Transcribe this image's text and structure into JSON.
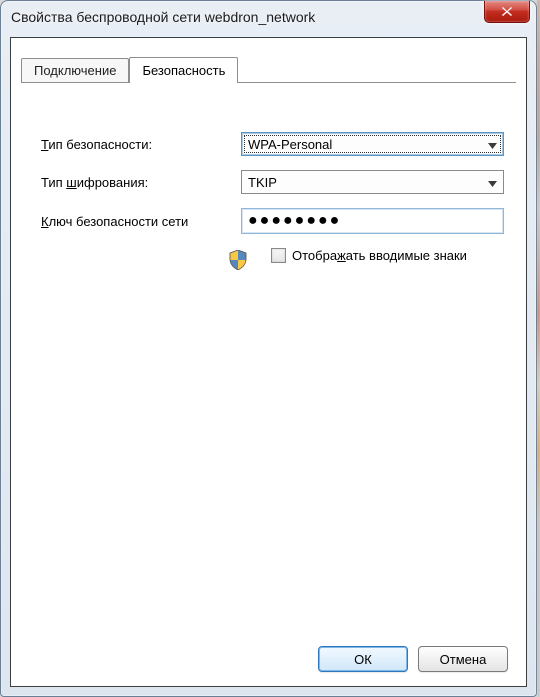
{
  "window": {
    "title": "Свойства беспроводной сети webdron_network"
  },
  "tabs": {
    "connection": "Подключение",
    "security": "Безопасность"
  },
  "labels": {
    "security_type_prefix": "Т",
    "security_type_rest": "ип безопасности:",
    "encryption_prefix": "Тип ",
    "encryption_ul": "ш",
    "encryption_rest": "ифрования:",
    "key_prefix": "К",
    "key_rest": "люч безопасности сети"
  },
  "values": {
    "security_type": "WPA-Personal",
    "encryption": "TKIP",
    "key_mask": "●●●●●●●●"
  },
  "checkbox": {
    "show_prefix": "Отобра",
    "show_ul": "ж",
    "show_rest": "ать вводимые знаки"
  },
  "buttons": {
    "ok": "ОК",
    "cancel": "Отмена"
  }
}
